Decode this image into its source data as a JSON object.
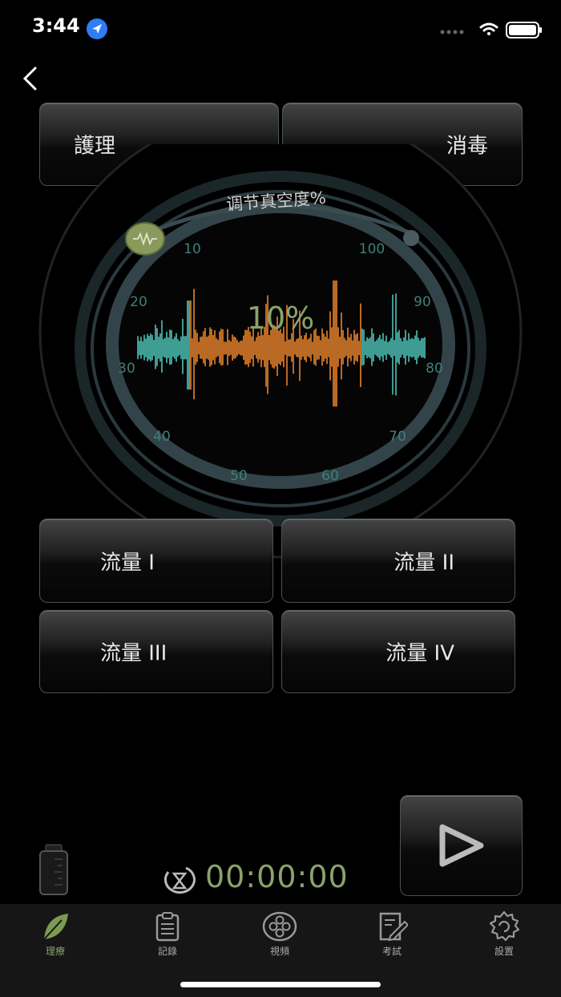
{
  "status": {
    "time": "3:44"
  },
  "top_buttons": {
    "left": "護理",
    "right": "消毒"
  },
  "dial": {
    "title": "调节真空度%",
    "value_text": "10%",
    "value": 10,
    "ticks": [
      "10",
      "20",
      "30",
      "40",
      "50",
      "60",
      "70",
      "80",
      "90",
      "100"
    ]
  },
  "flow_buttons": [
    "流量 I",
    "流量 II",
    "流量 III",
    "流量 IV"
  ],
  "timer": "00:00:00",
  "tabs": [
    {
      "label": "理療",
      "icon": "leaf-icon",
      "active": true
    },
    {
      "label": "記錄",
      "icon": "clipboard-icon",
      "active": false
    },
    {
      "label": "視頻",
      "icon": "film-reel-icon",
      "active": false
    },
    {
      "label": "考試",
      "icon": "exam-icon",
      "active": false
    },
    {
      "label": "設置",
      "icon": "gear-icon",
      "active": false
    }
  ],
  "colors": {
    "accent_green": "#8aa26c",
    "tick_teal": "#4a8b86",
    "wave_orange": "#e8842c",
    "wave_teal": "#4ec3b8"
  }
}
